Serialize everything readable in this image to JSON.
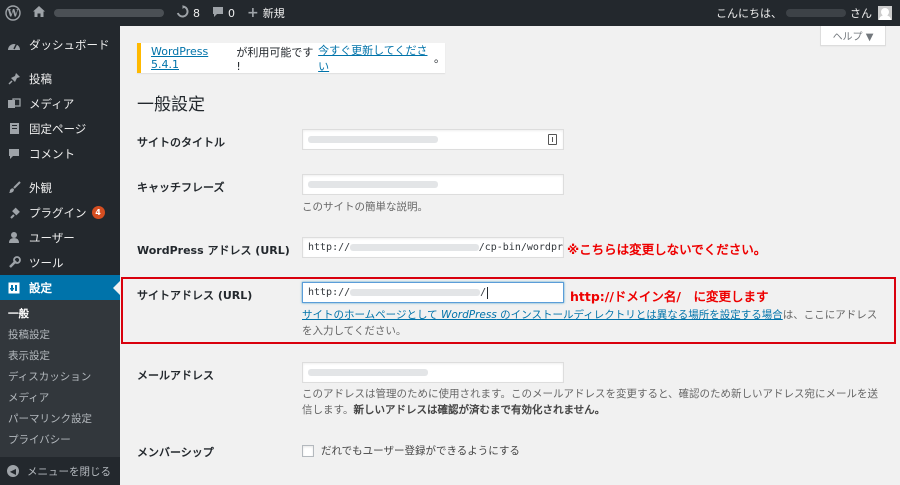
{
  "adminbar": {
    "updates_count": "8",
    "comments_count": "0",
    "new_label": "新規",
    "greeting": "こんにちは、",
    "greeting_suffix": "さん"
  },
  "sidebar": {
    "dashboard": "ダッシュボード",
    "posts": "投稿",
    "media": "メディア",
    "pages": "固定ページ",
    "comments": "コメント",
    "appearance": "外観",
    "plugins": "プラグイン",
    "plugins_badge": "4",
    "users": "ユーザー",
    "tools": "ツール",
    "settings": "設定",
    "submenu": [
      "一般",
      "投稿設定",
      "表示設定",
      "ディスカッション",
      "メディア",
      "パーマリンク設定",
      "プライバシー"
    ],
    "collapse": "メニューを閉じる"
  },
  "help_tab": "ヘルプ ▼",
  "notice": {
    "link1": "WordPress 5.4.1",
    "text": " が利用可能です ! ",
    "link2": "今すぐ更新してください",
    "end": "。"
  },
  "page_title": "一般設定",
  "form": {
    "site_title_label": "サイトのタイトル",
    "tagline_label": "キャッチフレーズ",
    "tagline_desc": "このサイトの簡単な説明。",
    "wpurl_label": "WordPress アドレス (URL)",
    "wpurl_prefix": "http://",
    "wpurl_suffix": "/cp-bin/wordpr",
    "wpurl_note": "※こちらは変更しないでください。",
    "siteurl_label": "サイトアドレス (URL)",
    "siteurl_prefix": "http://",
    "siteurl_suffix": "/",
    "siteurl_note": "http://ドメイン名/　に変更します",
    "siteurl_desc_link_a": "サイトのホームページとして ",
    "siteurl_desc_link_wp": "WordPress",
    "siteurl_desc_link_b": " のインストールディレクトリとは異なる場所を設定する場合",
    "siteurl_desc_rest1": "は、ここにアドレス",
    "siteurl_desc_rest2": "を入力してください。",
    "email_label": "メールアドレス",
    "email_desc1": "このアドレスは管理のために使用されます。このメールアドレスを変更すると、確認のため新しいアドレス宛にメールを送",
    "email_desc2a": "信します。",
    "email_desc2b": "新しいアドレスは確認が済むまで有効化されません。",
    "membership_label": "メンバーシップ",
    "membership_checkbox": "だれでもユーザー登録ができるようにする"
  },
  "colors": {
    "adminbar_bg": "#23282d",
    "accent": "#0073aa",
    "annotation": "#ee0000",
    "highlight_box": "#d9000d"
  }
}
